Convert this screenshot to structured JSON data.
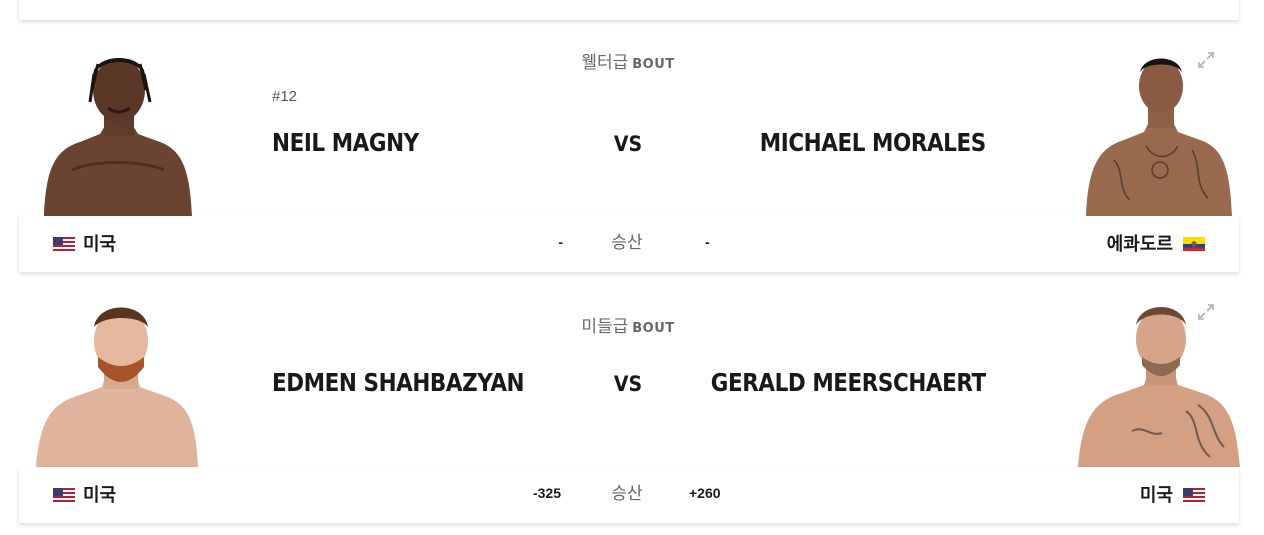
{
  "bouts": [
    {
      "weight_class": "웰터급",
      "bout_word": "BOUT",
      "left": {
        "rank": "#12",
        "name": "NEIL MAGNY",
        "country": "미국",
        "flag": "us-flag",
        "odds": "-"
      },
      "right": {
        "name": "MICHAEL MORALES",
        "country": "에콰도르",
        "flag": "ecuador-flag",
        "odds": "-"
      },
      "vs": "VS",
      "odds_label": "승산"
    },
    {
      "weight_class": "미들급",
      "bout_word": "BOUT",
      "left": {
        "name": "EDMEN SHAHBAZYAN",
        "country": "미국",
        "flag": "us-flag",
        "odds": "-325"
      },
      "right": {
        "name": "GERALD MEERSCHAERT",
        "country": "미국",
        "flag": "us-flag",
        "odds": "+260"
      },
      "vs": "VS",
      "odds_label": "승산"
    }
  ],
  "colors": {
    "name": "#191919",
    "muted": "#666666",
    "icon": "#b0b0b0"
  },
  "icons": {
    "expand": "expand-arrows-icon"
  }
}
